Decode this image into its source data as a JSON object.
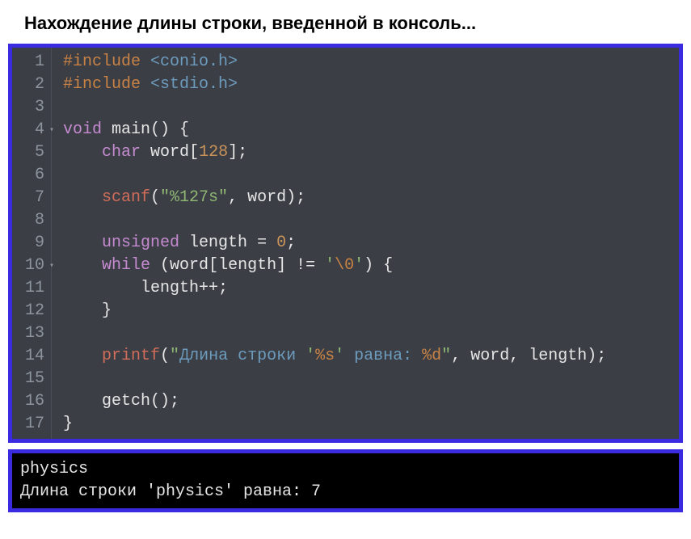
{
  "title": "Нахождение длины строки, введенной в консоль...",
  "code": {
    "line_count": 17,
    "fold_lines": [
      4,
      10
    ],
    "l1": {
      "pp": "#include",
      "inc": "<conio.h>"
    },
    "l2": {
      "pp": "#include",
      "inc": "<stdio.h>"
    },
    "l4": {
      "kw": "void",
      "fn": "main",
      "rest": "() {"
    },
    "l5": {
      "kw": "char",
      "var": "word",
      "open": "[",
      "num": "128",
      "close": "];"
    },
    "l7": {
      "fn": "scanf",
      "open": "(",
      "str": "\"%127s\"",
      "mid": ", word);",
      "var": "word"
    },
    "l9": {
      "kw": "unsigned",
      "var": "length",
      "eq": " = ",
      "num": "0",
      "end": ";"
    },
    "l10": {
      "kw": "while",
      "open": " (",
      "var1": "word",
      "br": "[",
      "var2": "length",
      "cl": "] != ",
      "ch_open": "'",
      "esc": "\\0",
      "ch_close": "'",
      "end": ") {"
    },
    "l11": {
      "var": "length",
      "op": "++;"
    },
    "l12": {
      "brace": "}"
    },
    "l14": {
      "fn": "printf",
      "open": "(",
      "s1": "\"",
      "ru1": "Длина строки ",
      "q1": "'",
      "fmt1": "%s",
      "q2": "'",
      "ru2": " равна: ",
      "fmt2": "%d",
      "s2": "\"",
      "args": ", word, length);"
    },
    "l16": {
      "fn": "getch",
      "rest": "();"
    },
    "l17": {
      "brace": "}"
    }
  },
  "console": {
    "line1": "physics",
    "line2": "Длина строки 'physics' равна: 7"
  }
}
